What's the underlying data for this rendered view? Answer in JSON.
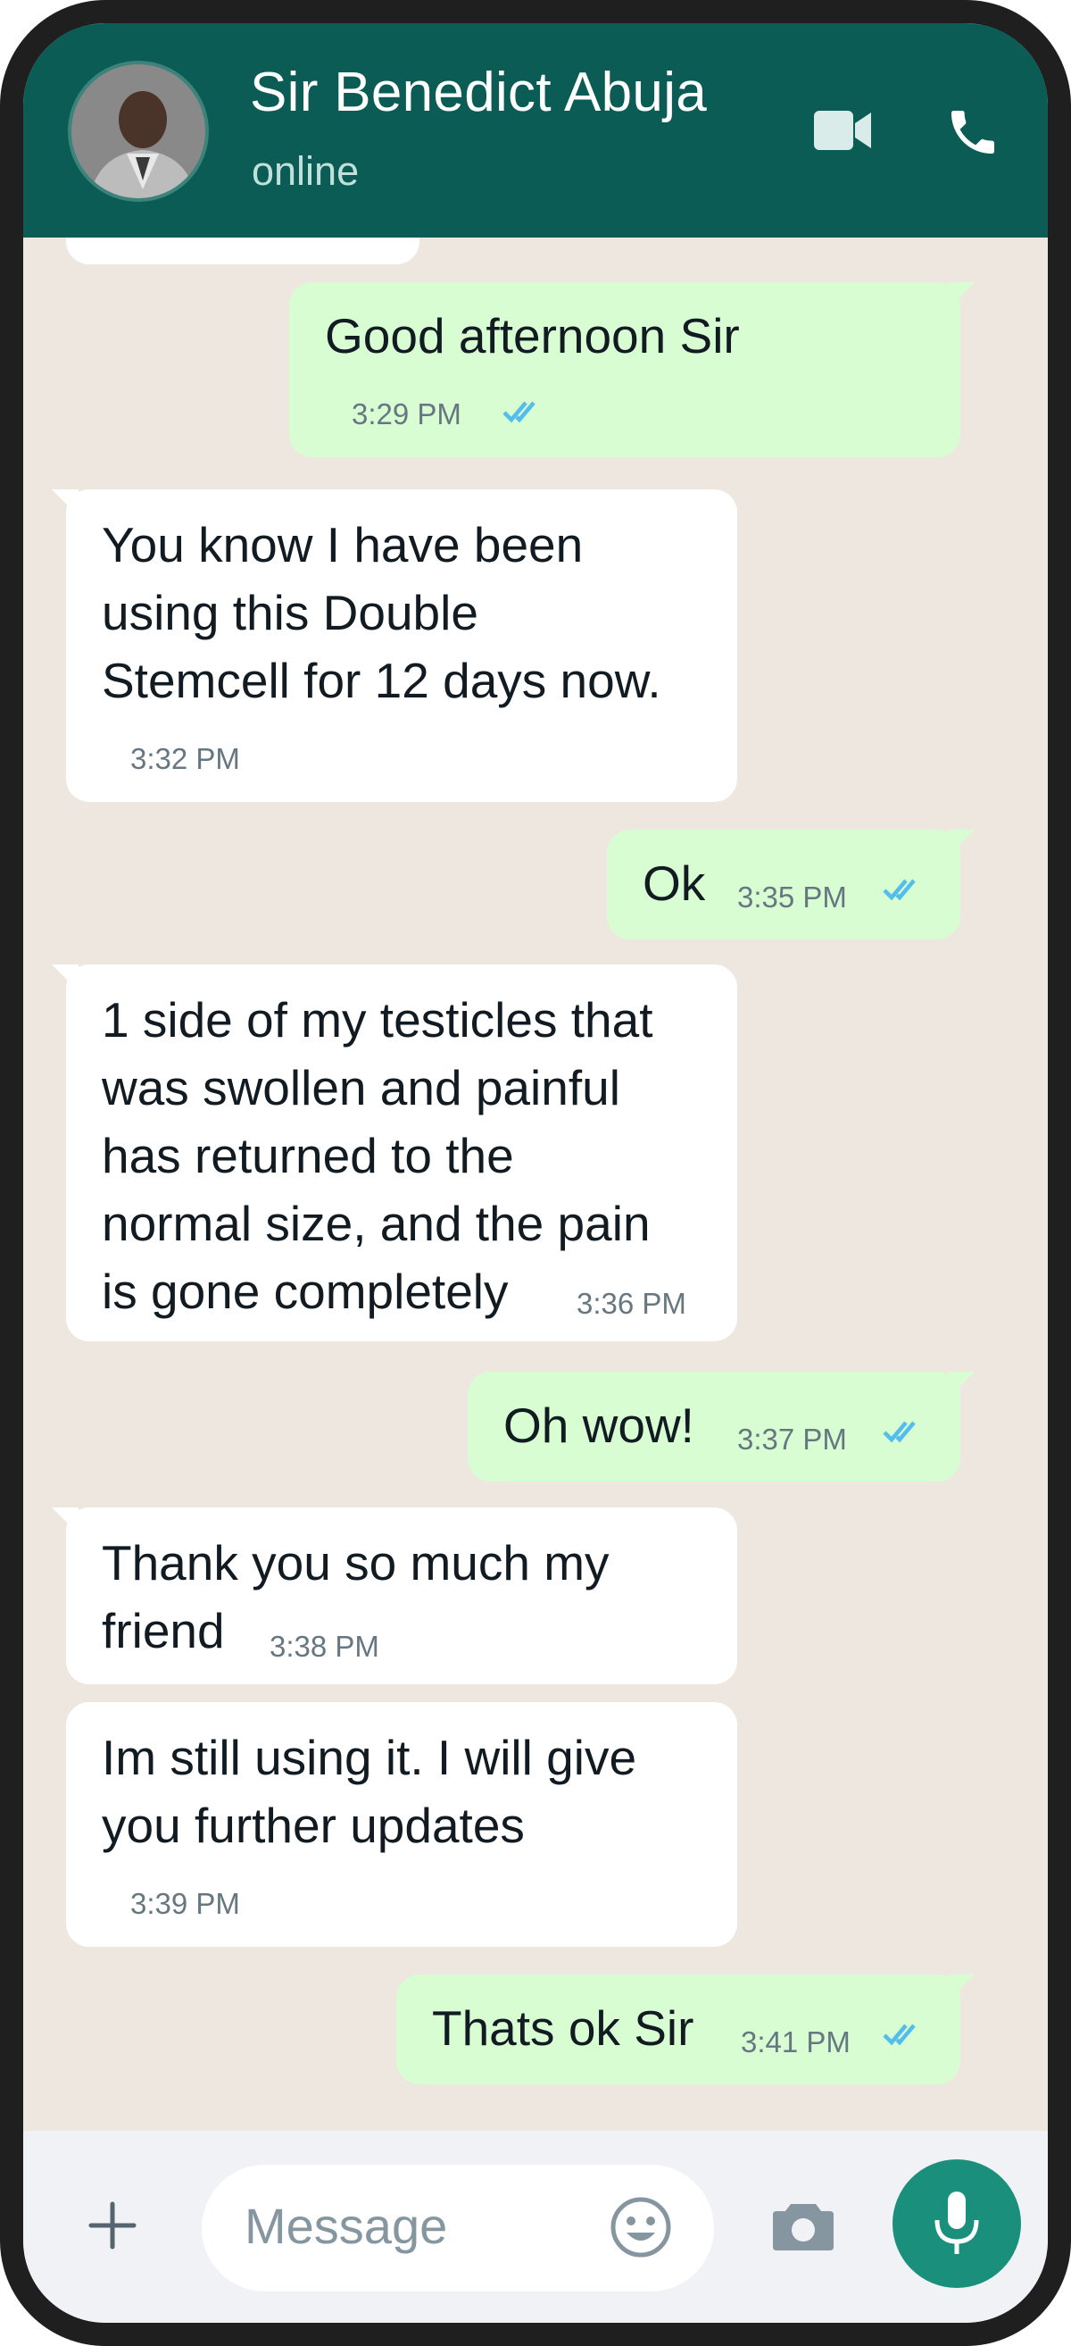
{
  "header": {
    "contact_name": "Sir Benedict Abuja",
    "status": "online",
    "icons": [
      "avatar",
      "video-call-icon",
      "voice-call-icon"
    ]
  },
  "messages": [
    {
      "direction": "outgoing",
      "text": "Good afternoon Sir",
      "time": "3:29 PM",
      "read": true
    },
    {
      "direction": "incoming",
      "text": "You know I have been\nusing this Double\nStemcell for 12 days now.",
      "time": "3:32 PM"
    },
    {
      "direction": "outgoing",
      "text": "Ok",
      "time": "3:35 PM",
      "read": true
    },
    {
      "direction": "incoming",
      "text": "1 side of my testicles that\nwas swollen and painful\nhas returned to the\nnormal size, and the pain\nis gone completely",
      "time": "3:36 PM"
    },
    {
      "direction": "outgoing",
      "text": "Oh wow!",
      "time": "3:37 PM",
      "read": true
    },
    {
      "direction": "incoming",
      "text": "Thank you so much my\nfriend",
      "time": "3:38 PM"
    },
    {
      "direction": "incoming",
      "text": "Im still using it. I will give\nyou further updates",
      "time": "3:39 PM"
    },
    {
      "direction": "outgoing",
      "text": "Thats ok Sir",
      "time": "3:41 PM",
      "read": true
    }
  ],
  "input": {
    "placeholder": "Message",
    "icons": [
      "plus-icon",
      "emoji-icon",
      "camera-icon",
      "microphone-icon"
    ]
  },
  "colors": {
    "header": "#0a5c54",
    "chat_background": "#ede7df",
    "outgoing_bubble": "#d9fdd3",
    "incoming_bubble": "#ffffff",
    "read_tick": "#53bdeb",
    "mic_button": "#1a8f7c"
  }
}
